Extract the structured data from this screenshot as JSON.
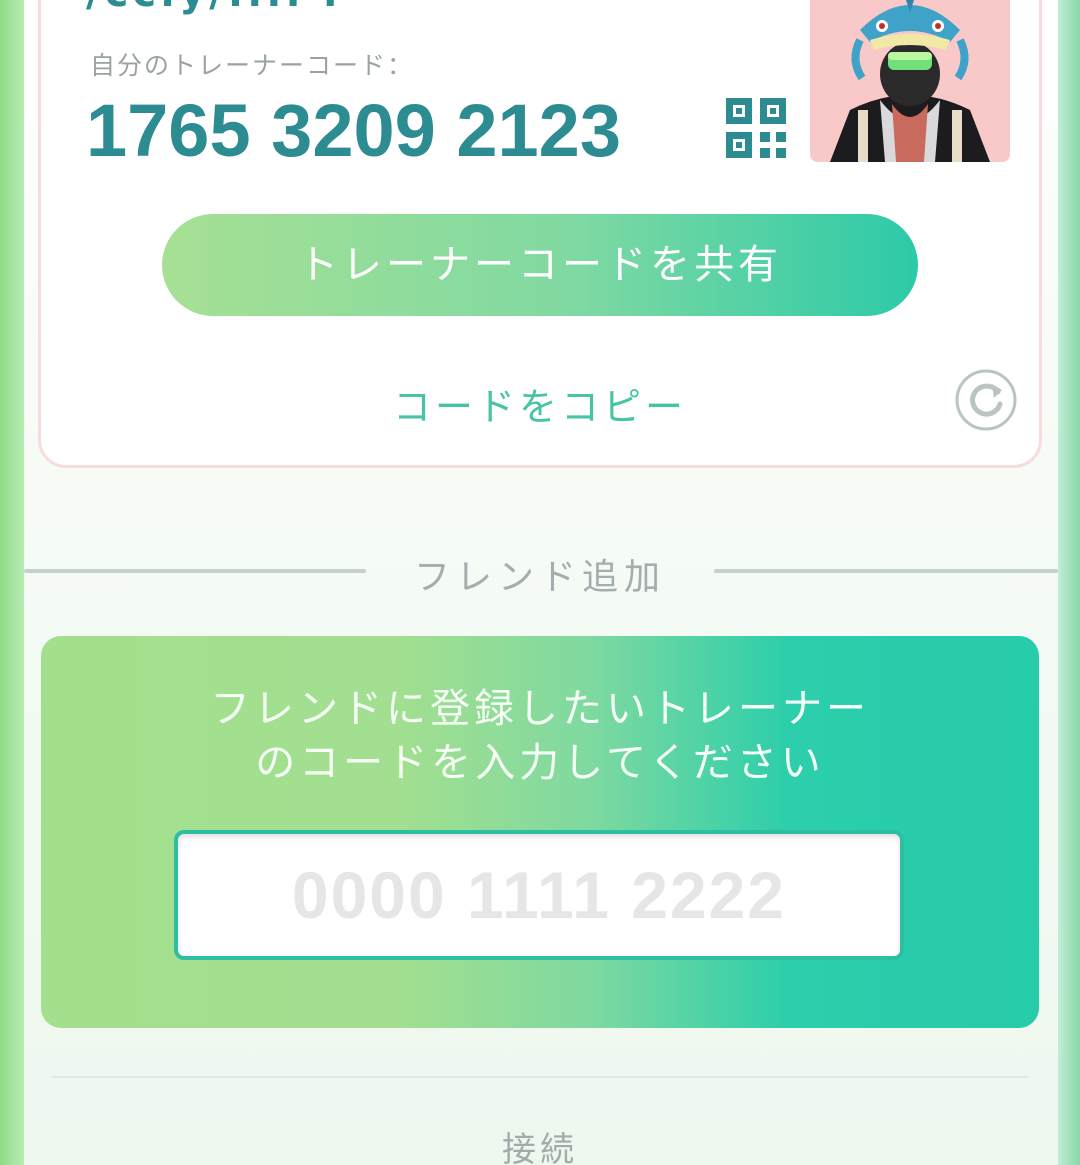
{
  "trainer_card": {
    "clipped_name": "/cc.y/.... .",
    "code_label": "自分のトレーナーコード：",
    "code_value": "1765 3209 2123",
    "share_button_label": "トレーナーコードを共有",
    "copy_link_label": "コードをコピー"
  },
  "add_friend": {
    "section_title": "フレンド追加",
    "instruction": "フレンドに登録したいトレーナーのコードを入力してください",
    "input_value": "",
    "input_placeholder": "0000 1111 2222"
  },
  "next_section": {
    "label": "接続"
  },
  "icons": {
    "qr": "qr-code-icon",
    "refresh": "refresh-icon",
    "avatar": "trainer-avatar"
  },
  "colors": {
    "accent_teal": "#2c8c92",
    "link_green": "#47c3a6",
    "gradient_start": "#a7e094",
    "gradient_end": "#2ccaa8"
  }
}
